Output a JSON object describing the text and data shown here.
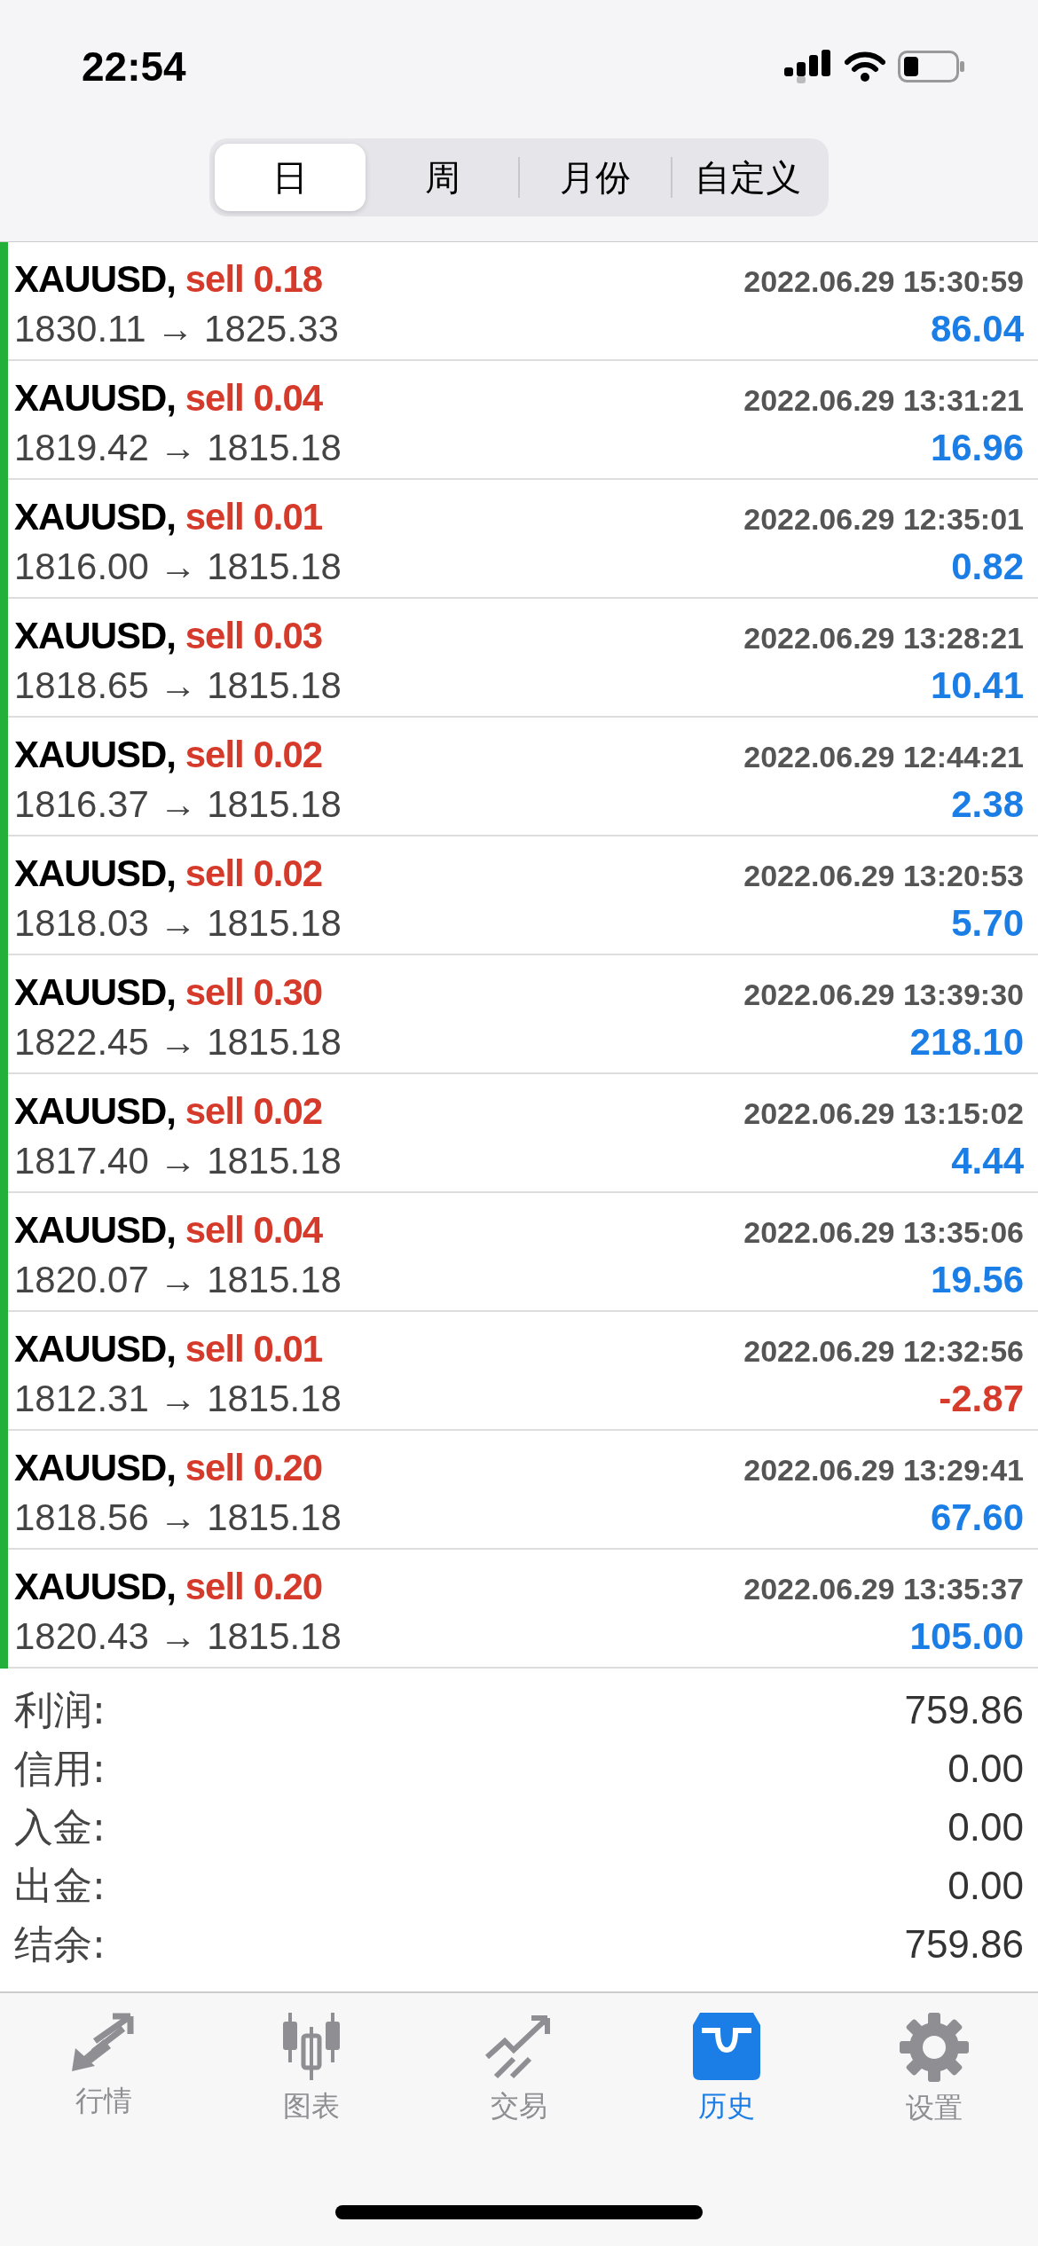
{
  "status_bar": {
    "time": "22:54"
  },
  "tabs": [
    {
      "label": "日",
      "selected": true
    },
    {
      "label": "周",
      "selected": false
    },
    {
      "label": "月份",
      "selected": false
    },
    {
      "label": "自定义",
      "selected": false
    }
  ],
  "deals": [
    {
      "symbol": "XAUUSD,",
      "side": "sell",
      "lot": "0.18",
      "time": "2022.06.29 15:30:59",
      "prices": "1830.11 → 1825.33",
      "profit": "86.04",
      "negative": false
    },
    {
      "symbol": "XAUUSD,",
      "side": "sell",
      "lot": "0.04",
      "time": "2022.06.29 13:31:21",
      "prices": "1819.42 → 1815.18",
      "profit": "16.96",
      "negative": false
    },
    {
      "symbol": "XAUUSD,",
      "side": "sell",
      "lot": "0.01",
      "time": "2022.06.29 12:35:01",
      "prices": "1816.00 → 1815.18",
      "profit": "0.82",
      "negative": false
    },
    {
      "symbol": "XAUUSD,",
      "side": "sell",
      "lot": "0.03",
      "time": "2022.06.29 13:28:21",
      "prices": "1818.65 → 1815.18",
      "profit": "10.41",
      "negative": false
    },
    {
      "symbol": "XAUUSD,",
      "side": "sell",
      "lot": "0.02",
      "time": "2022.06.29 12:44:21",
      "prices": "1816.37 → 1815.18",
      "profit": "2.38",
      "negative": false
    },
    {
      "symbol": "XAUUSD,",
      "side": "sell",
      "lot": "0.02",
      "time": "2022.06.29 13:20:53",
      "prices": "1818.03 → 1815.18",
      "profit": "5.70",
      "negative": false
    },
    {
      "symbol": "XAUUSD,",
      "side": "sell",
      "lot": "0.30",
      "time": "2022.06.29 13:39:30",
      "prices": "1822.45 → 1815.18",
      "profit": "218.10",
      "negative": false
    },
    {
      "symbol": "XAUUSD,",
      "side": "sell",
      "lot": "0.02",
      "time": "2022.06.29 13:15:02",
      "prices": "1817.40 → 1815.18",
      "profit": "4.44",
      "negative": false
    },
    {
      "symbol": "XAUUSD,",
      "side": "sell",
      "lot": "0.04",
      "time": "2022.06.29 13:35:06",
      "prices": "1820.07 → 1815.18",
      "profit": "19.56",
      "negative": false
    },
    {
      "symbol": "XAUUSD,",
      "side": "sell",
      "lot": "0.01",
      "time": "2022.06.29 12:32:56",
      "prices": "1812.31 → 1815.18",
      "profit": "-2.87",
      "negative": true
    },
    {
      "symbol": "XAUUSD,",
      "side": "sell",
      "lot": "0.20",
      "time": "2022.06.29 13:29:41",
      "prices": "1818.56 → 1815.18",
      "profit": "67.60",
      "negative": false
    },
    {
      "symbol": "XAUUSD,",
      "side": "sell",
      "lot": "0.20",
      "time": "2022.06.29 13:35:37",
      "prices": "1820.43 → 1815.18",
      "profit": "105.00",
      "negative": false
    }
  ],
  "summary": [
    {
      "label": "利润:",
      "value": "759.86"
    },
    {
      "label": "信用:",
      "value": "0.00"
    },
    {
      "label": "入金:",
      "value": "0.00"
    },
    {
      "label": "出金:",
      "value": "0.00"
    },
    {
      "label": "结余:",
      "value": "759.86"
    }
  ],
  "nav": [
    {
      "label": "行情",
      "selected": false
    },
    {
      "label": "图表",
      "selected": false
    },
    {
      "label": "交易",
      "selected": false
    },
    {
      "label": "历史",
      "selected": true
    },
    {
      "label": "设置",
      "selected": false
    }
  ]
}
